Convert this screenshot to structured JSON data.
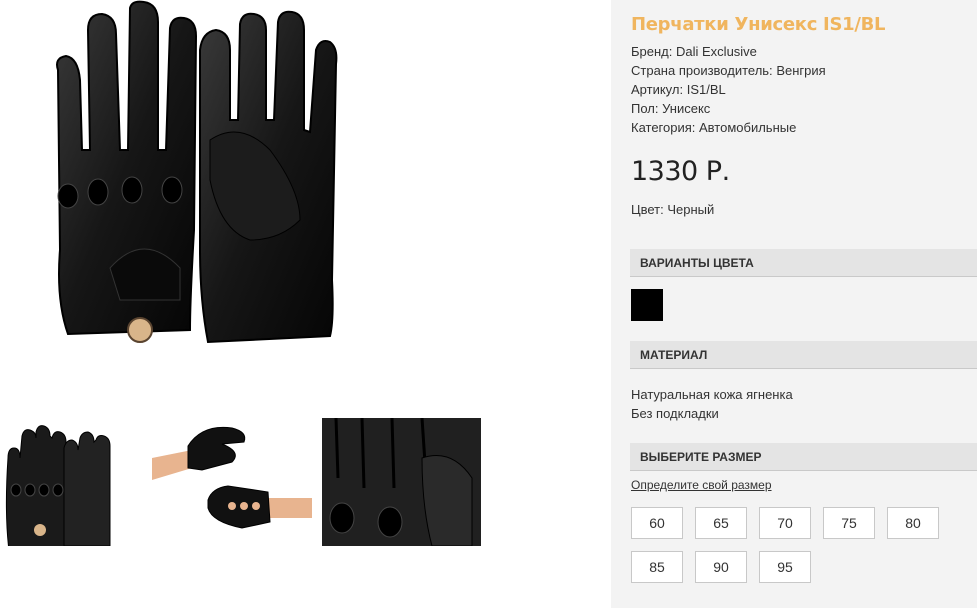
{
  "product": {
    "title": "Перчатки Унисекс IS1/BL",
    "specs": [
      {
        "label": "Бренд:",
        "value": "Dali Exclusive"
      },
      {
        "label": "Страна производитель:",
        "value": "Венгрия"
      },
      {
        "label": "Артикул:",
        "value": "IS1/BL"
      },
      {
        "label": "Пол:",
        "value": "Унисекс"
      },
      {
        "label": "Категория:",
        "value": "Автомобильные"
      }
    ],
    "price": "1330 Р.",
    "color_label": "Цвет:",
    "color_value": "Черный"
  },
  "color_variants": {
    "heading": "ВАРИАНТЫ ЦВЕТА",
    "swatches": [
      {
        "color": "#000000",
        "name": "Черный"
      }
    ]
  },
  "material": {
    "heading": "МАТЕРИАЛ",
    "lines": [
      "Натуральная кожа ягненка",
      "Без подкладки"
    ]
  },
  "size": {
    "heading": "ВЫБЕРИТЕ РАЗМЕР",
    "link": "Определите свой размер",
    "options": [
      "60",
      "65",
      "70",
      "75",
      "80",
      "85",
      "90",
      "95"
    ]
  },
  "colors": {
    "title_accent": "#f0b55e",
    "panel_bg": "#f3f3f3",
    "section_bg": "#e4e4e4"
  }
}
